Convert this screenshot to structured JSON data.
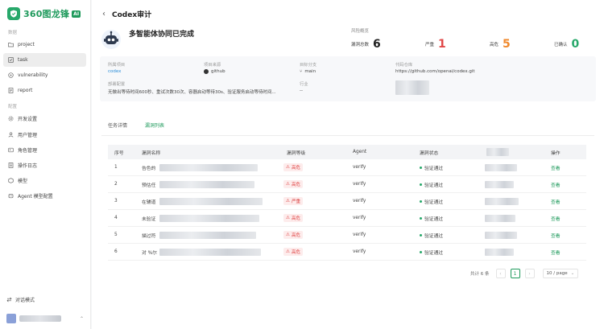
{
  "brand": {
    "name": "360图龙锋",
    "badge": "AI"
  },
  "sidebar": {
    "groups": [
      {
        "title": "数据",
        "items": [
          {
            "label": "project",
            "icon": "folder-icon"
          },
          {
            "label": "task",
            "icon": "task-icon",
            "active": true
          },
          {
            "label": "vulnerability",
            "icon": "bug-icon"
          },
          {
            "label": "report",
            "icon": "report-icon"
          }
        ]
      },
      {
        "title": "配置",
        "items": [
          {
            "label": "开发设置",
            "icon": "settings-icon"
          },
          {
            "label": "用户管理",
            "icon": "user-icon"
          },
          {
            "label": "角色管理",
            "icon": "role-icon"
          },
          {
            "label": "操作日志",
            "icon": "log-icon"
          },
          {
            "label": "模型",
            "icon": "model-icon"
          },
          {
            "label": "Agent 模型配置",
            "icon": "agent-icon"
          }
        ]
      }
    ],
    "footer_chat": "对话模式"
  },
  "page": {
    "back": "‹",
    "title": "Codex审计"
  },
  "task": {
    "title": "多智能体协同已完成",
    "stats_label": "风险概览",
    "stats": [
      {
        "label": "漏洞总数",
        "value": "6",
        "color": "#222222"
      },
      {
        "label": "严重",
        "value": "1",
        "color": "#e04848"
      },
      {
        "label": "高危",
        "value": "5",
        "color": "#f0892d"
      },
      {
        "label": "已确认",
        "value": "0",
        "color": "#27a86a"
      }
    ]
  },
  "info": {
    "project_label": "所属项目",
    "project_value": "codex",
    "source_label": "项目来源",
    "source_value": "github",
    "branch_label": "目标分支",
    "branch_value": "main",
    "repo_label": "代码仓库",
    "repo_value": "https://github.com/openai/codex.git",
    "config_label": "部署配置",
    "config_value": "无做出等待时间600秒、重试次数30次、容器启动等待30s、验证服务启动等待时间...",
    "industry_label": "行业",
    "industry_value": "--"
  },
  "tabs": [
    {
      "label": "任务详情"
    },
    {
      "label": "漏洞列表",
      "active": true
    }
  ],
  "table": {
    "headers": {
      "index": "序号",
      "name": "漏洞名称",
      "level": "漏洞等级",
      "agent": "Agent",
      "status": "漏洞状态",
      "action": "操作"
    },
    "rows": [
      {
        "index": "1",
        "name": "告色的",
        "level": "高危",
        "agent": "verify",
        "status": "验证通过",
        "action": "查看"
      },
      {
        "index": "2",
        "name": "预估任",
        "level": "高危",
        "agent": "verify",
        "status": "验证通过",
        "action": "查看"
      },
      {
        "index": "3",
        "name": "在辅道",
        "level": "严重",
        "agent": "verify",
        "status": "验证通过",
        "action": "查看"
      },
      {
        "index": "4",
        "name": "未验证",
        "level": "高危",
        "agent": "verify",
        "status": "验证通过",
        "action": "查看"
      },
      {
        "index": "5",
        "name": "描过符",
        "level": "高危",
        "agent": "verify",
        "status": "验证通过",
        "action": "查看"
      },
      {
        "index": "6",
        "name": "对 %尔",
        "level": "高危",
        "agent": "verify",
        "status": "验证通过",
        "action": "查看"
      }
    ]
  },
  "pagination": {
    "total": "共计 6 条",
    "prev": "‹",
    "current": "1",
    "next": "›",
    "page_size": "10 / page"
  }
}
